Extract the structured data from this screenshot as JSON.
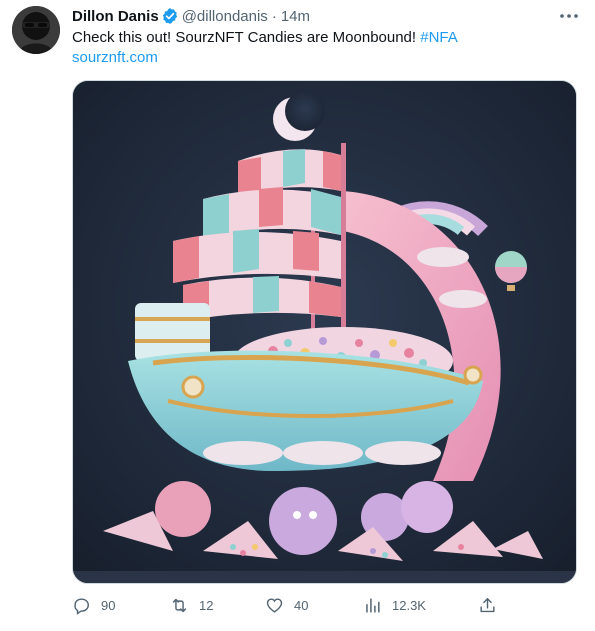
{
  "post": {
    "author_name": "Dillon Danis",
    "handle": "@dillondanis",
    "separator": "·",
    "time": "14m",
    "text": "Check this out! SourzNFT Candies are Moonbound! ",
    "hashtag": "#NFA",
    "link": "sourznft.com"
  },
  "metrics": {
    "replies": "90",
    "reposts": "12",
    "likes": "40",
    "views": "12.3K"
  },
  "icons": {
    "verified": "verified-badge-icon",
    "more": "more-icon",
    "reply": "reply-icon",
    "repost": "repost-icon",
    "like": "heart-icon",
    "views": "views-icon",
    "share": "share-icon"
  },
  "colors": {
    "link": "#1d9bf0",
    "verified": "#1d9bf0",
    "muted": "#536471",
    "text": "#0f1419",
    "media_background": "#1f2a3c"
  }
}
